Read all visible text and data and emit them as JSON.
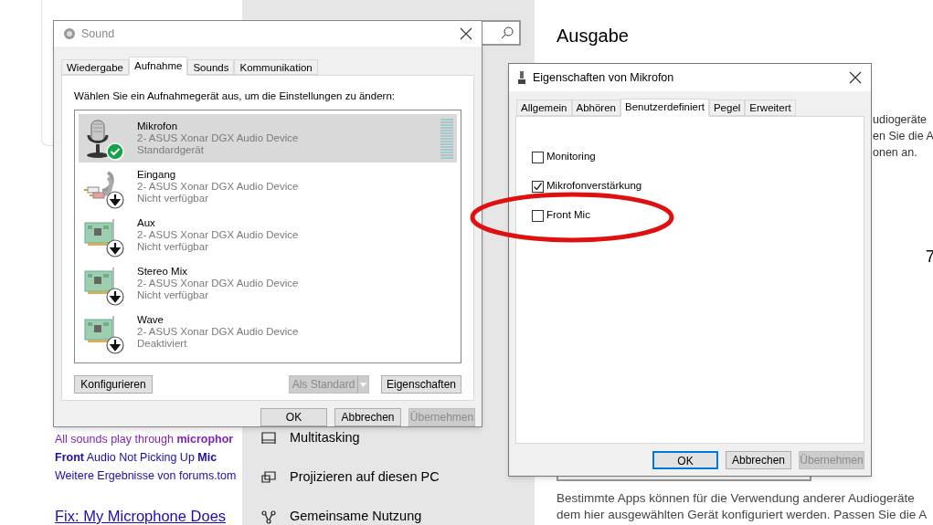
{
  "browser_page": {
    "results": [
      {
        "text": "All sounds play through **microphor**",
        "visited": true
      },
      {
        "text": "**Front** Audio Not Picking Up **Mic**",
        "visited": false
      },
      {
        "text": "Weitere Ergebnisse von forums.tom",
        "visited": false
      }
    ],
    "heading_link": "Fix: My Microphone Does"
  },
  "settings": {
    "nav_items": [
      {
        "label": "Multitasking",
        "kind": "multitasking"
      },
      {
        "label": "Projizieren auf diesen PC",
        "kind": "project"
      },
      {
        "label": "Gemeinsame Nutzung",
        "kind": "share"
      }
    ],
    "section_title": "Ausgabe",
    "partial_lines": [
      "udiogeräte",
      "en Sie die A",
      "onen an."
    ],
    "fragment": "7",
    "description": [
      "Bestimmte Apps können für die Verwendung anderer Audiogeräte",
      "dem hier ausgewählten Gerät konfiguriert werden. Passen Sie die A"
    ]
  },
  "sound_dialog": {
    "title": "Sound",
    "tabs": [
      {
        "label": "Wiedergabe",
        "selected": false
      },
      {
        "label": "Aufnahme",
        "selected": true
      },
      {
        "label": "Sounds",
        "selected": false
      },
      {
        "label": "Kommunikation",
        "selected": false
      }
    ],
    "prompt": "Wählen Sie ein Aufnahmegerät aus, um die Einstellungen zu ändern:",
    "devices": [
      {
        "name": "Mikrofon",
        "device": "2- ASUS Xonar DGX Audio Device",
        "status": "Standardgerät",
        "kind": "microphone",
        "default": true,
        "selected": true
      },
      {
        "name": "Eingang",
        "device": "2- ASUS Xonar DGX Audio Device",
        "status": "Nicht verfügbar",
        "kind": "cable",
        "default": false,
        "selected": false
      },
      {
        "name": "Aux",
        "device": "2- ASUS Xonar DGX Audio Device",
        "status": "Nicht verfügbar",
        "kind": "card",
        "default": false,
        "selected": false
      },
      {
        "name": "Stereo Mix",
        "device": "2- ASUS Xonar DGX Audio Device",
        "status": "Nicht verfügbar",
        "kind": "card",
        "default": false,
        "selected": false
      },
      {
        "name": "Wave",
        "device": "2- ASUS Xonar DGX Audio Device",
        "status": "Deaktiviert",
        "kind": "card",
        "default": false,
        "selected": false
      }
    ],
    "configure": {
      "label": "Konfigurieren",
      "disabled": false
    },
    "set_default": {
      "label": "Als Standard",
      "disabled": true
    },
    "properties": {
      "label": "Eigenschaften",
      "disabled": false
    },
    "footer": [
      {
        "label": "OK",
        "disabled": false
      },
      {
        "label": "Abbrechen",
        "disabled": false
      },
      {
        "label": "Übernehmen",
        "disabled": true
      }
    ]
  },
  "mic_dialog": {
    "title": "Eigenschaften von Mikrofon",
    "tabs": [
      {
        "label": "Allgemein",
        "selected": false
      },
      {
        "label": "Abhören",
        "selected": false
      },
      {
        "label": "Benutzerdefiniert",
        "selected": true
      },
      {
        "label": "Pegel",
        "selected": false
      },
      {
        "label": "Erweitert",
        "selected": false
      }
    ],
    "options": [
      {
        "label": "Monitoring",
        "checked": false
      },
      {
        "label": "Mikrofonverstärkung",
        "checked": true
      },
      {
        "label": "Front Mic",
        "checked": false
      }
    ],
    "footer": [
      {
        "label": "OK",
        "disabled": false,
        "focused": true
      },
      {
        "label": "Abbrechen",
        "disabled": false,
        "focused": false
      },
      {
        "label": "Übernehmen",
        "disabled": true,
        "focused": false
      }
    ]
  }
}
